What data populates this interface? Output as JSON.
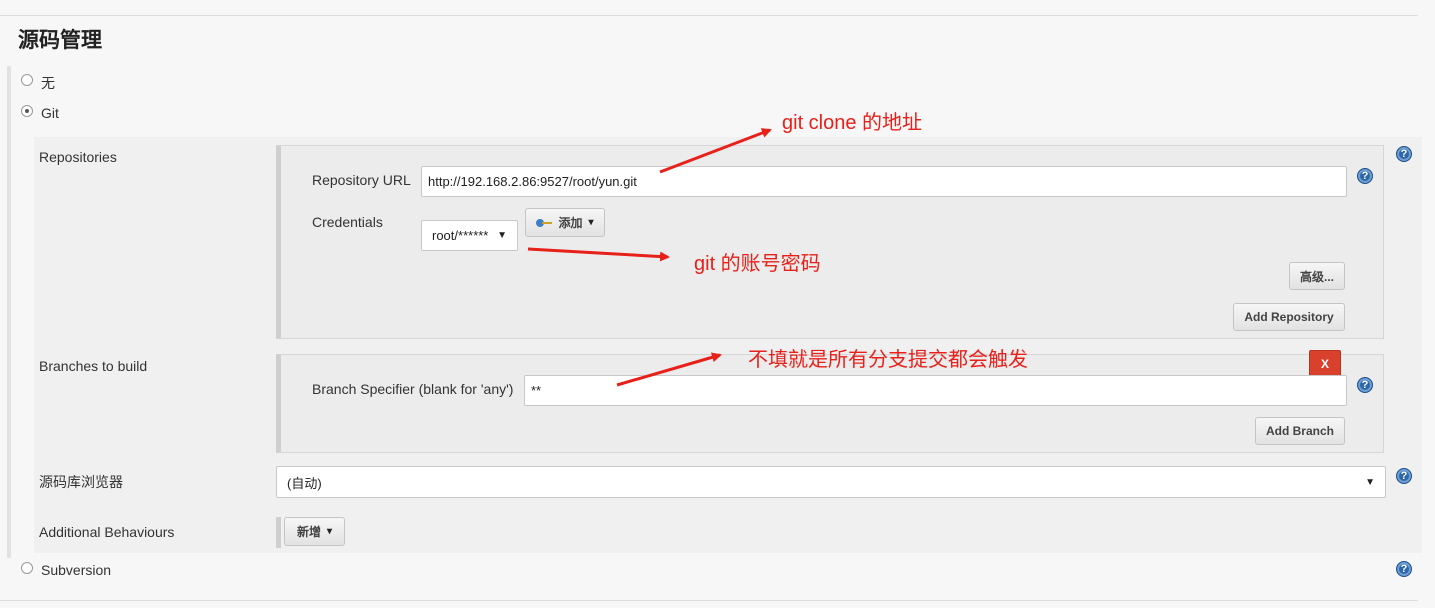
{
  "section_title": "源码管理",
  "scm_options": {
    "none": "无",
    "git": "Git",
    "subversion": "Subversion"
  },
  "repositories": {
    "label": "Repositories",
    "url_label": "Repository URL",
    "url_value": "http://192.168.2.86:9527/root/yun.git",
    "credentials_label": "Credentials",
    "credentials_value": "root/******",
    "add_button": "添加",
    "advanced_button": "高级...",
    "add_repository_button": "Add Repository"
  },
  "branches": {
    "label": "Branches to build",
    "specifier_label": "Branch Specifier (blank for 'any')",
    "specifier_value": "**",
    "delete_button": "X",
    "add_branch_button": "Add Branch"
  },
  "browser": {
    "label": "源码库浏览器",
    "value": "(自动)"
  },
  "behaviours": {
    "label": "Additional Behaviours",
    "add_button": "新增"
  },
  "help_glyph": "?",
  "annotations": {
    "clone_url": "git clone 的地址",
    "credentials": "git 的账号密码",
    "branches": "不填就是所有分支提交都会触发"
  },
  "colors": {
    "annotation": "#e8201a",
    "delete_button": "#d9412d",
    "help_icon": "#2d67a8"
  }
}
